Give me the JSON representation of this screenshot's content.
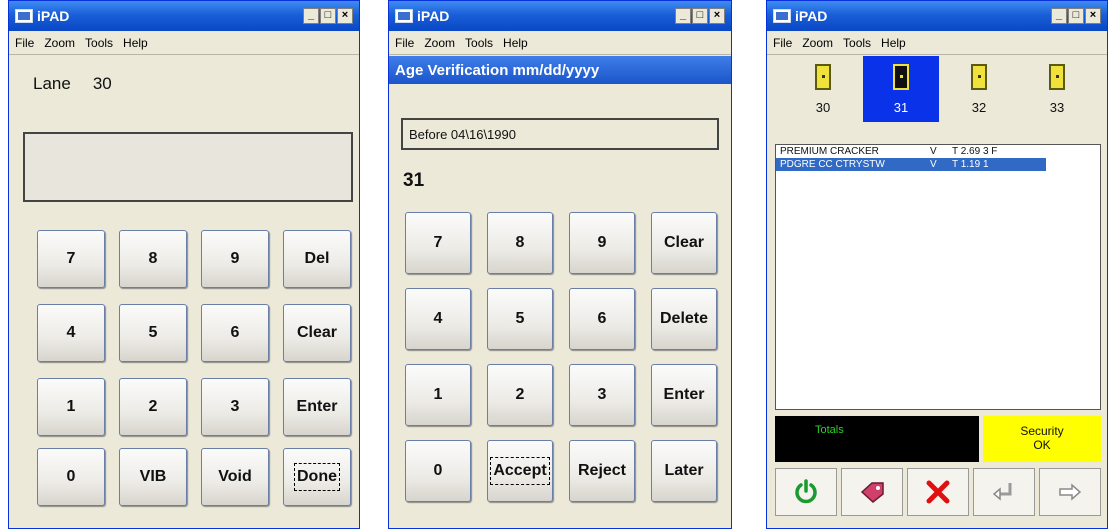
{
  "window1": {
    "title": "iPAD",
    "menu": [
      "File",
      "Zoom",
      "Tools",
      "Help"
    ],
    "lane_label": "Lane",
    "lane_value": "30",
    "display_value": "",
    "keys": [
      "7",
      "8",
      "9",
      "Del",
      "4",
      "5",
      "6",
      "Clear",
      "1",
      "2",
      "3",
      "Enter",
      "0",
      "VIB",
      "Void",
      "Done"
    ]
  },
  "window2": {
    "title": "iPAD",
    "menu": [
      "File",
      "Zoom",
      "Tools",
      "Help"
    ],
    "header": "Age Verification mm/dd/yyyy",
    "field_value": "Before 04\\16\\1990",
    "entry_value": "31",
    "keys": [
      "7",
      "8",
      "9",
      "Clear",
      "4",
      "5",
      "6",
      "Delete",
      "1",
      "2",
      "3",
      "Enter",
      "0",
      "Accept",
      "Reject",
      "Later"
    ]
  },
  "window3": {
    "title": "iPAD",
    "menu": [
      "File",
      "Zoom",
      "Tools",
      "Help"
    ],
    "lanes": [
      "30",
      "31",
      "32",
      "33"
    ],
    "selected_lane": "31",
    "items": [
      {
        "name": "PREMIUM CRACKER",
        "flag": "V",
        "price": "T 2.69 3 F"
      },
      {
        "name": "PDGRE CC CTRYSTW",
        "flag": "V",
        "price": "T 1.19 1"
      }
    ],
    "totals_label": "Totals",
    "security_label": "Security",
    "security_status": "OK",
    "toolbar_icons": [
      "power-icon",
      "tag-icon",
      "cancel-x-icon",
      "return-arrow-icon",
      "forward-arrow-icon"
    ],
    "colors": {
      "selected_lane": "#0a32e8",
      "security_bg": "#ffff00",
      "totals_bg": "#000000",
      "totals_text": "#2dd12d"
    }
  }
}
